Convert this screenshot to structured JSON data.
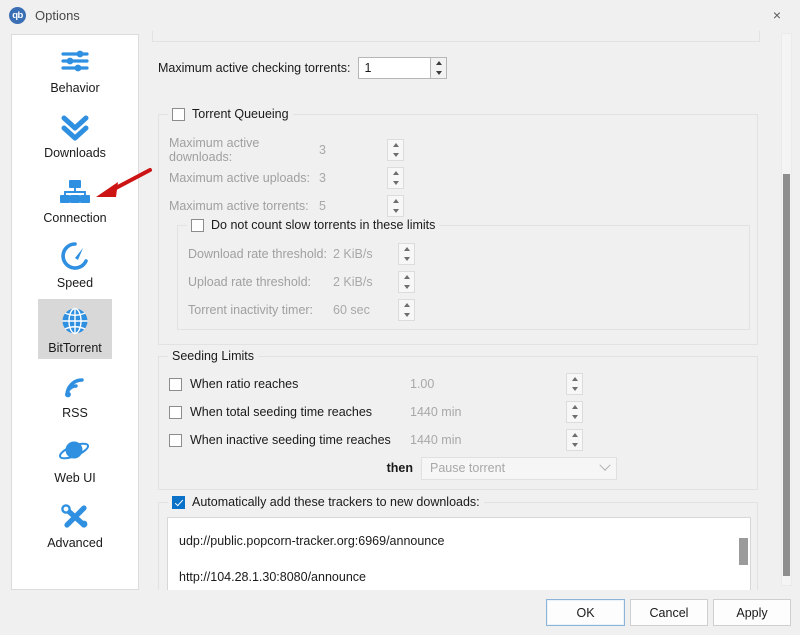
{
  "window": {
    "title": "Options",
    "app_icon": "qb",
    "app_icon_label": "qbittorrent-logo-icon",
    "close_label": "×"
  },
  "sidebar": {
    "items": [
      {
        "label": "Behavior",
        "icon": "sliders-icon",
        "selected": false
      },
      {
        "label": "Downloads",
        "icon": "double-chevron-down-icon",
        "selected": false
      },
      {
        "label": "Connection",
        "icon": "network-icon",
        "selected": false
      },
      {
        "label": "Speed",
        "icon": "speedometer-icon",
        "selected": false
      },
      {
        "label": "BitTorrent",
        "icon": "globe-icon",
        "selected": true
      },
      {
        "label": "RSS",
        "icon": "rss-icon",
        "selected": false
      },
      {
        "label": "Web UI",
        "icon": "planet-icon",
        "selected": false
      },
      {
        "label": "Advanced",
        "icon": "tools-icon",
        "selected": false
      }
    ]
  },
  "main": {
    "max_checking": {
      "label": "Maximum active checking torrents:",
      "value": "1"
    },
    "torrent_queueing": {
      "title": "Torrent Queueing",
      "checked": false,
      "rows": [
        {
          "label": "Maximum active downloads:",
          "value": "3"
        },
        {
          "label": "Maximum active uploads:",
          "value": "3"
        },
        {
          "label": "Maximum active torrents:",
          "value": "5"
        }
      ],
      "slow_group": {
        "title": "Do not count slow torrents in these limits",
        "checked": false,
        "rows": [
          {
            "label": "Download rate threshold:",
            "value": "2 KiB/s"
          },
          {
            "label": "Upload rate threshold:",
            "value": "2 KiB/s"
          },
          {
            "label": "Torrent inactivity timer:",
            "value": "60 sec"
          }
        ]
      }
    },
    "seeding_limits": {
      "title": "Seeding Limits",
      "rows": [
        {
          "label": "When ratio reaches",
          "value": "1.00",
          "checked": false
        },
        {
          "label": "When total seeding time reaches",
          "value": "1440 min",
          "checked": false
        },
        {
          "label": "When inactive seeding time reaches",
          "value": "1440 min",
          "checked": false
        }
      ],
      "then_label": "then",
      "then_value": "Pause torrent"
    },
    "trackers": {
      "title": "Automatically add these trackers to new downloads:",
      "checked": true,
      "lines": [
        "udp://public.popcorn-tracker.org:6969/announce",
        "http://104.28.1.30:8080/announce"
      ]
    }
  },
  "footer": {
    "ok": "OK",
    "cancel": "Cancel",
    "apply": "Apply"
  },
  "annotation": {
    "arrow_color": "#cc1414",
    "points_to": "Connection"
  },
  "colors": {
    "accent": "#0a71c8",
    "icon_blue": "#2f8fe0",
    "selection_gray": "#d8d8d8"
  }
}
